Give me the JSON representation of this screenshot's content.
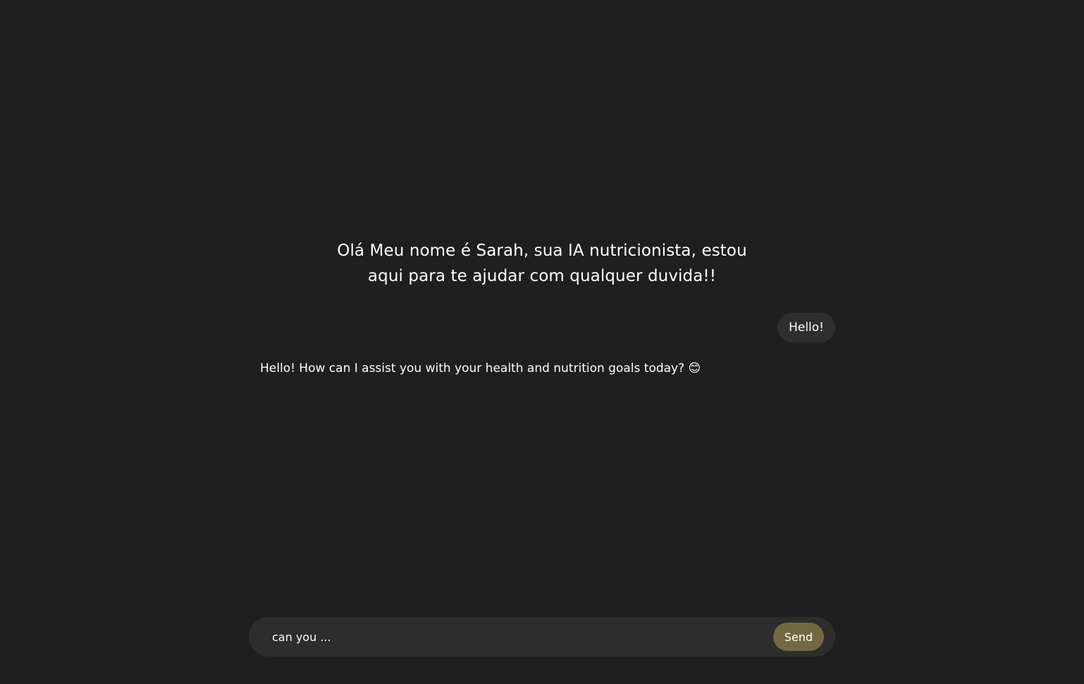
{
  "greeting": {
    "line1": "Olá Meu nome é Sarah, sua IA nutricionista, estou",
    "line2": "aqui para te ajudar com qualquer duvida!!"
  },
  "messages": [
    {
      "role": "user",
      "text": "Hello!"
    },
    {
      "role": "assistant",
      "text": "Hello! How can I assist you with your health and nutrition goals today? 😊"
    }
  ],
  "composer": {
    "value": "can you ...",
    "send_label": "Send"
  },
  "colors": {
    "background": "#1f1f1f",
    "bubble": "#2e2e2e",
    "composer": "#2d2d2d",
    "send_button": "#726842",
    "text": "#ffffff"
  }
}
